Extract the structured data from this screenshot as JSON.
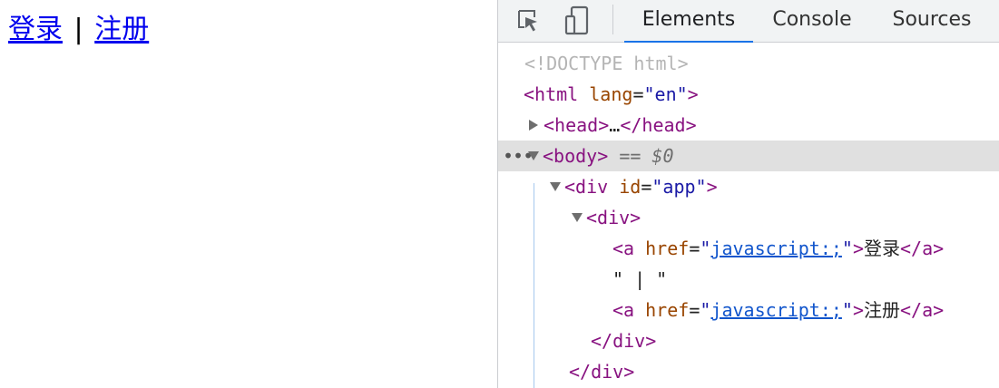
{
  "page": {
    "login_link": "登录",
    "separator": "|",
    "register_link": "注册"
  },
  "devtools": {
    "tabs": [
      {
        "label": "Elements",
        "active": true
      },
      {
        "label": "Console",
        "active": false
      },
      {
        "label": "Sources",
        "active": false
      }
    ],
    "icons": [
      "inspect-element-icon",
      "device-toolbar-icon"
    ],
    "tree": {
      "doctype": "<!DOCTYPE html>",
      "html_tag": "html",
      "html_attr": "lang",
      "html_val": "\"en\"",
      "head_tag": "head",
      "head_ellipsis": "…",
      "body_tag": "body",
      "body_selected_marker": "== $0",
      "div_app_tag": "div",
      "div_app_attr": "id",
      "div_app_val": "\"app\"",
      "div_tag": "div",
      "a1_tag": "a",
      "a1_attr": "href",
      "a1_val": "javascript:;",
      "a1_text": "登录",
      "text_node": "\" | \"",
      "a2_tag": "a",
      "a2_attr": "href",
      "a2_val": "javascript:;",
      "a2_text": "注册",
      "close_div": "/div",
      "close_div_app": "/div"
    },
    "colors": {
      "tag": "#881280",
      "attr_name": "#994500",
      "attr_value": "#1a1aa6",
      "selection": "#e0e0e0",
      "active_tab_underline": "#1a73e8"
    }
  }
}
